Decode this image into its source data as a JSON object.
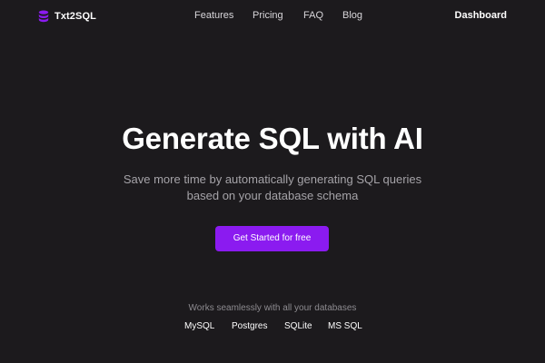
{
  "header": {
    "brand": {
      "name": "Txt2SQL",
      "icon": "database-icon"
    },
    "nav": {
      "features": "Features",
      "pricing": "Pricing",
      "faq": "FAQ",
      "blog": "Blog"
    },
    "dashboard_label": "Dashboard"
  },
  "hero": {
    "title": "Generate SQL with AI",
    "subtitle": "Save more time by automatically generating SQL queries based on your database schema",
    "cta_label": "Get Started for free"
  },
  "databases": {
    "intro": "Works seamlessly with all your databases",
    "items": [
      "MySQL",
      "Postgres",
      "SQLite",
      "MS SQL"
    ]
  },
  "colors": {
    "background": "#1c1a1d",
    "accent": "#8b1bf0",
    "text_primary": "#ffffff",
    "text_secondary": "#a5a3a8"
  }
}
